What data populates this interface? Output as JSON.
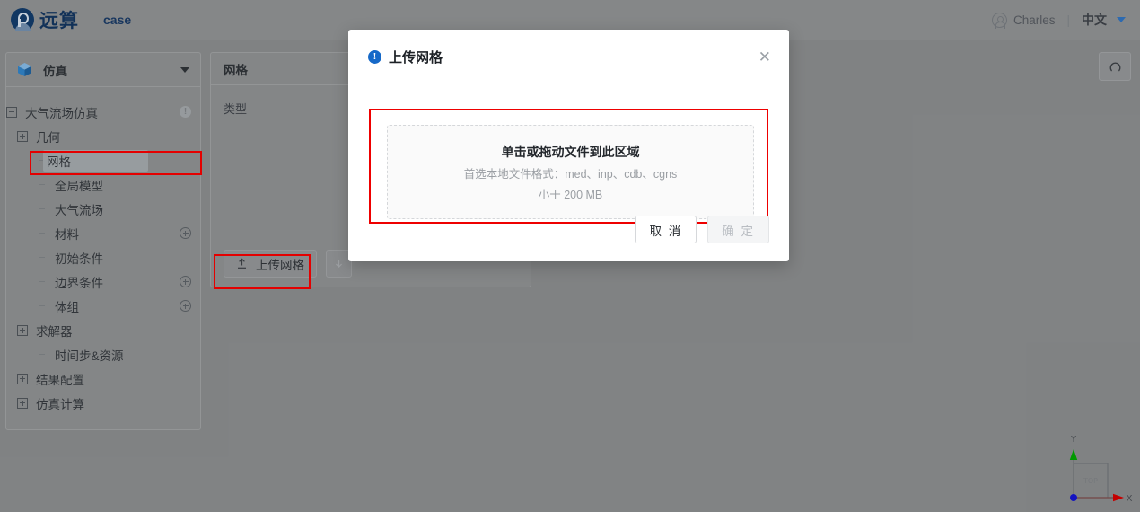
{
  "topbar": {
    "brand_name": "远算",
    "case_label": "case",
    "user_name": "Charles",
    "separator": "|",
    "language": "中文",
    "icons": {
      "logo": "yuansuan-logo",
      "avatar": "user-avatar-icon",
      "caret": "chevron-down-icon"
    }
  },
  "sidebar": {
    "header": {
      "label": "仿真",
      "icon": "cube-icon",
      "caret": "chevron-down-icon"
    },
    "tree": [
      {
        "label": "大气流场仿真",
        "indent": 0,
        "toggle": "minus",
        "badge": "info",
        "selected": false
      },
      {
        "label": "几何",
        "indent": 1,
        "toggle": "plus",
        "badge": "none",
        "selected": false
      },
      {
        "label": "网格",
        "indent": 2,
        "toggle": "leaf",
        "badge": "none",
        "selected": true
      },
      {
        "label": "全局模型",
        "indent": 2,
        "toggle": "leaf",
        "badge": "none",
        "selected": false
      },
      {
        "label": "大气流场",
        "indent": 2,
        "toggle": "leaf",
        "badge": "none",
        "selected": false
      },
      {
        "label": "材料",
        "indent": 2,
        "toggle": "leaf",
        "badge": "plus",
        "selected": false
      },
      {
        "label": "初始条件",
        "indent": 2,
        "toggle": "leaf",
        "badge": "none",
        "selected": false
      },
      {
        "label": "边界条件",
        "indent": 2,
        "toggle": "leaf",
        "badge": "plus",
        "selected": false
      },
      {
        "label": "体组",
        "indent": 2,
        "toggle": "leaf",
        "badge": "plus",
        "selected": false
      },
      {
        "label": "求解器",
        "indent": 1,
        "toggle": "plus",
        "badge": "none",
        "selected": false
      },
      {
        "label": "时间步&资源",
        "indent": 2,
        "toggle": "leaf",
        "badge": "none",
        "selected": false
      },
      {
        "label": "结果配置",
        "indent": 1,
        "toggle": "plus",
        "badge": "none",
        "selected": false
      },
      {
        "label": "仿真计算",
        "indent": 1,
        "toggle": "plus",
        "badge": "none",
        "selected": false
      }
    ],
    "info_badge_char": "!"
  },
  "panel": {
    "title": "网格",
    "field_label": "类型",
    "upload_button": "上传网格",
    "upload_icon": "upload-icon",
    "download_button_icon": "download-arrow-icon"
  },
  "viewport": {
    "reset_button_icon": "reset-view-icon",
    "gizmo": {
      "y_label": "Y",
      "x_label": "X",
      "face_label": "TOP",
      "y_axis_color": "#00a000",
      "x_axis_color": "#cc0000",
      "origin_color": "#0000cc"
    }
  },
  "modal": {
    "title": "上传网格",
    "info_icon": "info-circle-icon",
    "close_icon": "close-icon",
    "close_glyph": "✕",
    "info_glyph": "!",
    "dropzone": {
      "primary_text": "单击或拖动文件到此区域",
      "format_text": "首选本地文件格式：med、inp、cdb、cgns",
      "size_text": "小于 200 MB"
    },
    "cancel_button": "取 消",
    "confirm_button": "确 定"
  },
  "colors": {
    "accent_blue": "#1669c8",
    "brand_blue": "#12335c",
    "highlight_red": "#ee0000",
    "app_background": "#868889"
  }
}
